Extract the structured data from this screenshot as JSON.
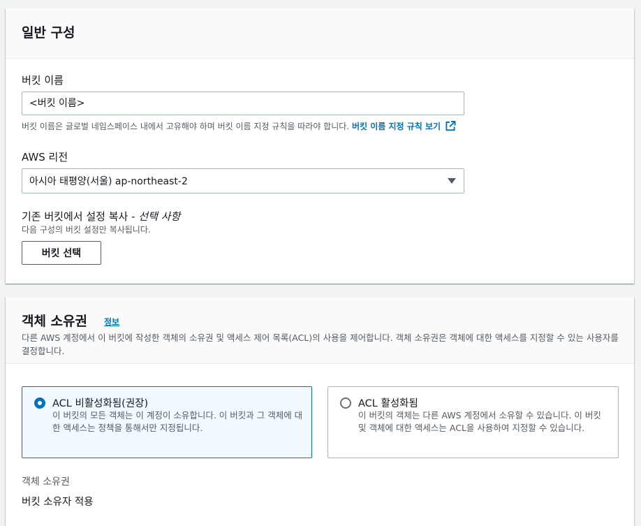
{
  "general": {
    "title": "일반 구성",
    "bucket_name_label": "버킷 이름",
    "bucket_name_placeholder": "<버킷 이름>",
    "bucket_name_hint": "버킷 이름은 글로벌 네임스페이스 내에서 고유해야 하며 버킷 이름 지정 규칙을 따라야 합니다.",
    "naming_rules_link": "버킷 이름 지정 규칙 보기",
    "region_label": "AWS 리전",
    "region_value": "아시아 태평양(서울) ap-northeast-2",
    "copy_label": "기존 버킷에서 설정 복사 -",
    "copy_label_optional": "선택 사항",
    "copy_hint": "다음 구성의 버킷 설정만 복사됩니다.",
    "choose_bucket_button": "버킷 선택"
  },
  "ownership": {
    "title": "객체 소유권",
    "info_link": "정보",
    "description": "다른 AWS 계정에서 이 버킷에 작성한 객체의 소유권 및 액세스 제어 목록(ACL)의 사용을 제어합니다. 객체 소유권은 객체에 대한 액세스를 지정할 수 있는 사용자를 결정합니다.",
    "options": [
      {
        "title": "ACL 비활성화됨(권장)",
        "description": "이 버킷의 모든 객체는 이 계정이 소유합니다. 이 버킷과 그 객체에 대한 액세스는 정책을 통해서만 지정됩니다.",
        "selected": true
      },
      {
        "title": "ACL 활성화됨",
        "description": "이 버킷의 객체는 다른 AWS 계정에서 소유할 수 있습니다. 이 버킷 및 객체에 대한 액세스는 ACL을 사용하여 지정할 수 있습니다.",
        "selected": false
      }
    ],
    "summary_label": "객체 소유권",
    "summary_value": "버킷 소유자 적용"
  },
  "colors": {
    "accent": "#0073bb",
    "text": "#16191f",
    "secondary_text": "#545b64",
    "selected_tile_bg": "#f1faff"
  },
  "icons": {
    "external_link": "external-link-icon",
    "dropdown": "caret-down-icon"
  }
}
